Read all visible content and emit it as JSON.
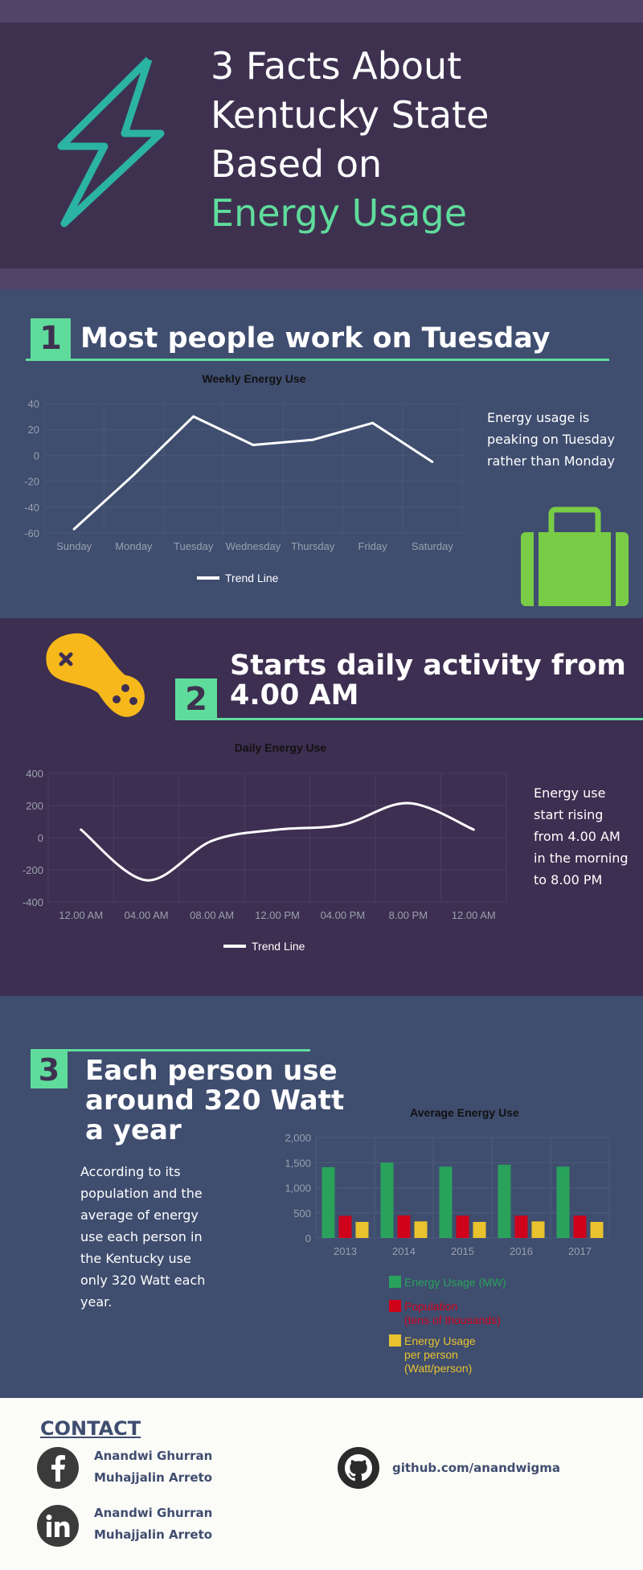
{
  "header": {
    "title_lines": [
      "3 Facts About",
      "Kentucky State",
      "Based on"
    ],
    "title_accent": "Energy Usage",
    "icon": "lightning-bolt-icon"
  },
  "colors": {
    "accent": "#5fdc9c",
    "header_bg": "#3e3150",
    "section_blue": "#3f4d6f",
    "section_purple": "#3d2f51",
    "bolt": "#2bb3a3",
    "briefcase": "#79cc46",
    "gamepad": "#f7b81c",
    "energy_bar": "#29a35b",
    "population_bar": "#d0021b",
    "per_person_bar": "#e8c32e"
  },
  "fact1": {
    "number": "1",
    "heading": "Most people work on Tuesday",
    "note": "Energy usage is peaking on Tuesday rather than Monday",
    "icon": "briefcase-icon"
  },
  "fact2": {
    "number": "2",
    "heading_lines": [
      "Starts daily activity from",
      "4.00 AM"
    ],
    "note": "Energy use start rising from 4.00 AM in the morning to 8.00 PM",
    "icon": "gamepad-icon"
  },
  "fact3": {
    "number": "3",
    "heading_lines": [
      "Each person use",
      "around 320 Watt",
      "a year"
    ],
    "note": "According to its population and the average of energy use each person in the Kentucky use only 320 Watt each year."
  },
  "contact": {
    "title": "CONTACT",
    "facebook_name": "Anandwi Ghurran Muhajjalin Arreto",
    "github": "github.com/anandwigma",
    "linkedin_name": "Anandwi Ghurran Muhajjalin Arreto",
    "icons": [
      "facebook-icon",
      "github-icon",
      "linkedin-icon"
    ]
  },
  "chart_data": [
    {
      "type": "line",
      "title": "Weekly Energy Use",
      "categories": [
        "Sunday",
        "Monday",
        "Tuesday",
        "Wednesday",
        "Thursday",
        "Friday",
        "Saturday"
      ],
      "series": [
        {
          "name": "Trend Line",
          "values": [
            -57,
            -15,
            30,
            8,
            12,
            25,
            -5
          ]
        }
      ],
      "ylim": [
        -60,
        40
      ],
      "yticks": [
        "40",
        "20",
        "0",
        "-20",
        "-40",
        "-60"
      ],
      "grid": true,
      "legend": "bottom"
    },
    {
      "type": "line",
      "title": "Daily Energy Use",
      "categories": [
        "12.00 AM",
        "04.00 AM",
        "08.00 AM",
        "12.00 PM",
        "04.00 PM",
        "8.00 PM",
        "12.00 AM"
      ],
      "series": [
        {
          "name": "Trend Line",
          "values": [
            50,
            -265,
            -20,
            50,
            80,
            215,
            50
          ]
        }
      ],
      "ylim": [
        -400,
        400
      ],
      "yticks": [
        "400",
        "200",
        "0",
        "-200",
        "-400"
      ],
      "grid": true,
      "legend": "bottom"
    },
    {
      "type": "bar",
      "title": "Average Energy Use",
      "categories": [
        "2013",
        "2014",
        "2015",
        "2016",
        "2017"
      ],
      "series": [
        {
          "name": "Energy Usage (MW)",
          "values": [
            1410,
            1500,
            1420,
            1460,
            1420
          ]
        },
        {
          "name": "Population (tens of thousands)",
          "values": [
            440,
            450,
            445,
            445,
            445
          ]
        },
        {
          "name": "Energy Usage per person (Watt/person)",
          "values": [
            320,
            330,
            320,
            330,
            320
          ]
        }
      ],
      "ylim": [
        0,
        2000
      ],
      "yticks": [
        "2,000",
        "1,500",
        "1,000",
        "500",
        "0"
      ],
      "grid": true,
      "legend": "bottom"
    }
  ]
}
